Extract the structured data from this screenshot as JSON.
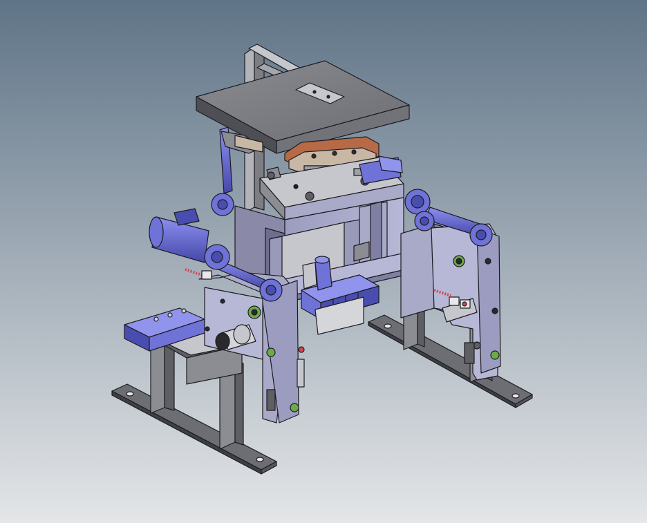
{
  "viewport": {
    "background_top": "#5f7487",
    "background_bottom": "#e4e6e8"
  },
  "model": {
    "parts": [
      "top-plate",
      "handle",
      "vertical-frame-bar",
      "suction-cup-assembly",
      "central-bracket",
      "main-frame-block",
      "left-gripper-arm",
      "right-gripper-arm",
      "left-cylinder",
      "right-cylinder",
      "left-base-rail",
      "right-base-rail",
      "valve-manifold",
      "left-valve-block",
      "sensors"
    ],
    "colors": {
      "steel_dark": "#5e5f63",
      "steel_mid": "#8c8d92",
      "steel_light": "#c6c7cc",
      "frame_lavender": "#a9a9c8",
      "frame_lavender_dark": "#7f7fa3",
      "actuator_blue": "#6f72d6",
      "actuator_blue_dark": "#4a4db0",
      "copper": "#b66a45",
      "edge": "#1c1c22",
      "sensor_red": "#d6454a",
      "sensor_green": "#6cab47"
    }
  }
}
